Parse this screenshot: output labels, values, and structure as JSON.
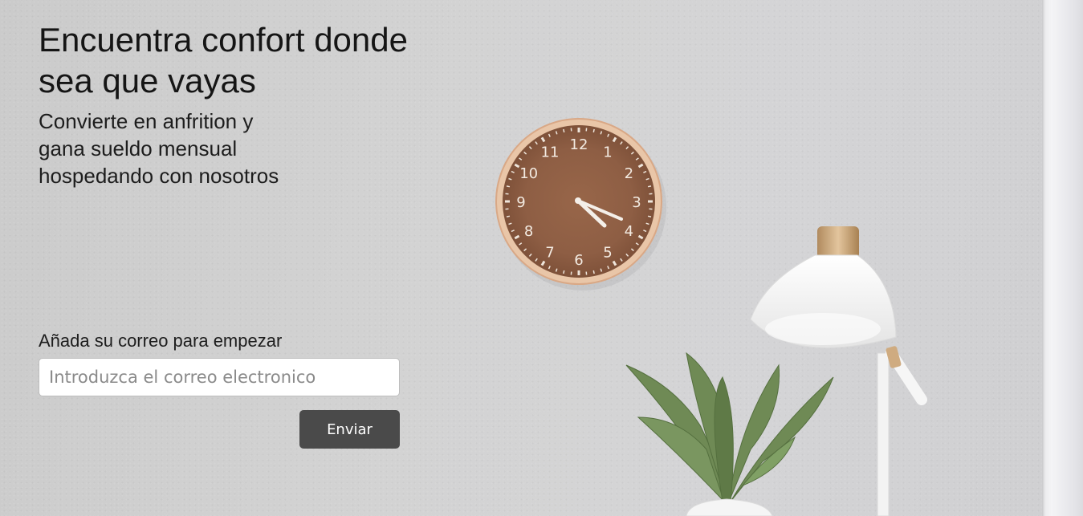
{
  "hero": {
    "headline": "Encuentra confort donde sea que vayas",
    "subheadline": "Convierte en anfrition y gana sueldo mensual hospedando con nosotros"
  },
  "signup": {
    "label": "Añada su correo para empezar",
    "email_placeholder": "Introduzca el correo electronico",
    "email_value": "",
    "submit_label": "Enviar"
  },
  "background": {
    "clock_numbers": [
      "12",
      "1",
      "2",
      "3",
      "4",
      "5",
      "6",
      "7",
      "8",
      "9",
      "10",
      "11"
    ],
    "clock_time": "4:22",
    "wall_color": "#d1d1d1",
    "clock_face_color": "#8e5e44",
    "clock_rim_color": "#e8c4a6",
    "plant_color": "#6f8a55",
    "lamp_color": "#f5f5f5",
    "button_color": "#4a4a4a"
  }
}
